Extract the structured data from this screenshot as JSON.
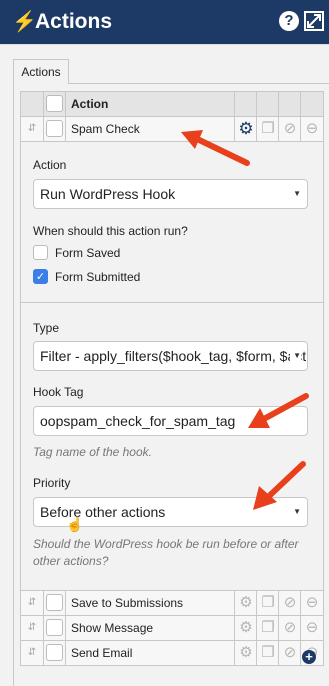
{
  "window": {
    "title": "Actions",
    "help_label": "?",
    "icon": "bolt-icon"
  },
  "tabs": [
    {
      "label": "Actions"
    }
  ],
  "grid": {
    "header": {
      "action_label": "Action"
    }
  },
  "active_action": {
    "label": "Spam Check",
    "settings": {
      "action_label": "Action",
      "action_value": "Run WordPress Hook",
      "when_label": "When should this action run?",
      "form_saved_label": "Form Saved",
      "form_saved_checked": false,
      "form_submitted_label": "Form Submitted",
      "form_submitted_checked": true,
      "type_label": "Type",
      "type_value": "Filter - apply_filters($hook_tag, $form, $action)",
      "hook_tag_label": "Hook Tag",
      "hook_tag_value": "oopspam_check_for_spam_tag",
      "hook_tag_help": "Tag name of the hook.",
      "priority_label": "Priority",
      "priority_value": "Before other actions",
      "priority_help": "Should the WordPress hook be run before or after other actions?"
    }
  },
  "other_actions": [
    {
      "label": "Save to Submissions"
    },
    {
      "label": "Show Message"
    },
    {
      "label": "Send Email"
    }
  ],
  "colors": {
    "titlebar": "#1d3a66",
    "accent": "#3a7ee6",
    "arrow": "#e8401c"
  }
}
